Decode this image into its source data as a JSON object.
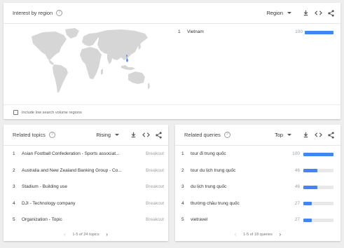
{
  "interest_by_region": {
    "title": "Interest by region",
    "dropdown_value": "Region",
    "rows": [
      {
        "rank": "1",
        "name": "Vietnam",
        "value": "100",
        "fraction": 1.0
      }
    ],
    "checkbox_label": "Include low search volume regions",
    "checkbox_checked": false
  },
  "related_topics": {
    "title": "Related topics",
    "dropdown_value": "Rising",
    "rows": [
      {
        "rank": "1",
        "label": "Asian Football Confederation - Sports associat...",
        "value": "Breakout"
      },
      {
        "rank": "2",
        "label": "Australia and New Zealand Banking Group - Co...",
        "value": "Breakout"
      },
      {
        "rank": "3",
        "label": "Stadium - Building use",
        "value": "Breakout"
      },
      {
        "rank": "4",
        "label": "DJI - Technology company",
        "value": "Breakout"
      },
      {
        "rank": "5",
        "label": "Organization - Topic",
        "value": "Breakout"
      }
    ],
    "pager_text": "1-5 of 24 topics"
  },
  "related_queries": {
    "title": "Related queries",
    "dropdown_value": "Top",
    "rows": [
      {
        "rank": "1",
        "label": "tour đi trung quốc",
        "value": "100",
        "fraction": 1.0
      },
      {
        "rank": "2",
        "label": "tour du lịch trung quốc",
        "value": "46",
        "fraction": 0.46
      },
      {
        "rank": "3",
        "label": "du lịch trung quốc",
        "value": "46",
        "fraction": 0.46
      },
      {
        "rank": "4",
        "label": "thường châu trung quốc",
        "value": "27",
        "fraction": 0.27
      },
      {
        "rank": "5",
        "label": "vietravel",
        "value": "27",
        "fraction": 0.27
      }
    ],
    "pager_text": "1-5 of 18 queries"
  },
  "icons": {
    "help": "help-circle-icon",
    "download": "download-icon",
    "embed": "embed-code-icon",
    "share": "share-icon",
    "prev": "chevron-left-icon",
    "next": "chevron-right-icon"
  },
  "colors": {
    "bar": "#4285f4",
    "map_land": "#d6d6d6",
    "map_highlight": "#4285f4",
    "breakout": "#a0a0a0"
  }
}
